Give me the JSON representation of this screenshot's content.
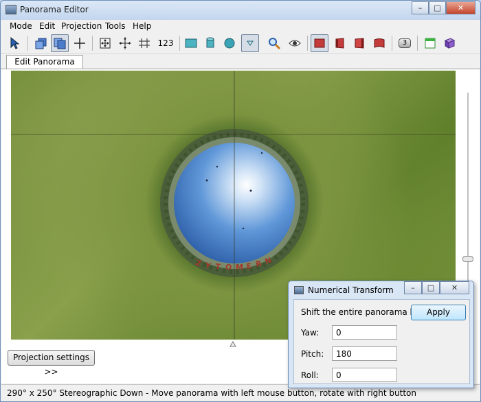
{
  "window": {
    "title": "Panorama Editor"
  },
  "menu": [
    "Mode",
    "Edit",
    "Projection",
    "Tools",
    "Help"
  ],
  "toolbar": {
    "items": [
      {
        "icon": "cursor-select-icon"
      },
      {
        "icon": "images-stack-icon"
      },
      {
        "icon": "image-pair-icon",
        "active": true
      },
      {
        "icon": "crosshair-icon"
      },
      {
        "icon": "fit-frame-icon"
      },
      {
        "icon": "move-center-icon"
      },
      {
        "icon": "align-horizon-icon"
      },
      {
        "icon": "numeric-icon",
        "label": "123"
      },
      {
        "icon": "rectilinear-icon"
      },
      {
        "icon": "cylinder-icon"
      },
      {
        "icon": "sphere-icon"
      },
      {
        "icon": "dropdown-triangle-icon",
        "active": true
      },
      {
        "icon": "zoom-icon"
      },
      {
        "icon": "eye-preview-icon"
      },
      {
        "icon": "cube-face-front-icon",
        "active": true
      },
      {
        "icon": "cube-face-side-icon"
      },
      {
        "icon": "cube-face-right-icon"
      },
      {
        "icon": "cube-face-warp-icon"
      },
      {
        "icon": "layer-count-icon",
        "label": "3"
      },
      {
        "icon": "window-green-icon"
      },
      {
        "icon": "book-icon"
      }
    ]
  },
  "tabs": [
    {
      "label": "Edit Panorama"
    }
  ],
  "projection_button": "Projection settings >>",
  "status": "290° x 250° Stereographic Down - Move panorama with left mouse button, rotate with right button",
  "dialog": {
    "title": "Numerical Transform",
    "heading": "Shift the entire panorama by:",
    "apply": "Apply",
    "fields": [
      {
        "label": "Yaw:",
        "value": "0"
      },
      {
        "label": "Pitch:",
        "value": "180"
      },
      {
        "label": "Roll:",
        "value": "0"
      }
    ]
  },
  "preview": {
    "letters": "ZYTOMERN"
  }
}
